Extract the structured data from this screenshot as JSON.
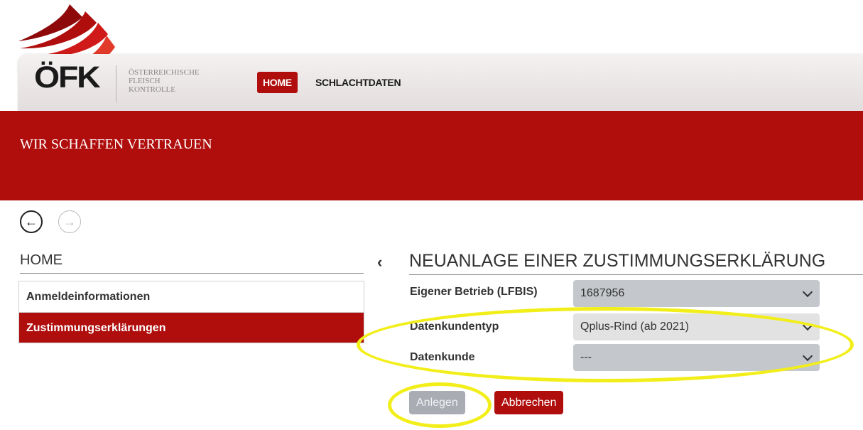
{
  "brand": {
    "logo_text": "ÖFK",
    "org_name": "ÖSTERREICHISCHE\nFLEISCH\nKONTROLLE",
    "tagline": "WIR SCHAFFEN VERTRAUEN",
    "accent_color": "#b00d0d"
  },
  "nav": {
    "home_label": "HOME",
    "schlachtdaten_label": "SCHLACHTDATEN"
  },
  "history": {
    "back_icon": "arrow-left-circle-icon",
    "forward_icon": "arrow-right-circle-icon"
  },
  "sidebar": {
    "title": "HOME",
    "items": [
      {
        "label": "Anmeldeinformationen",
        "active": false
      },
      {
        "label": "Zustimmungserklärungen",
        "active": true
      }
    ]
  },
  "main": {
    "collapse_icon": "chevron-left-icon",
    "title": "NEUANLAGE EINER ZUSTIMMUNGSERKLÄRUNG",
    "fields": {
      "betrieb": {
        "label": "Eigener Betrieb (LFBIS)",
        "value": "1687956"
      },
      "datenkundentyp": {
        "label": "Datenkundentyp",
        "value": "Qplus-Rind (ab 2021)"
      },
      "datenkunde": {
        "label": "Datenkunde",
        "value": "---"
      }
    },
    "buttons": {
      "create": "Anlegen",
      "cancel": "Abbrechen"
    }
  },
  "highlight_color": "#f2ee1a"
}
